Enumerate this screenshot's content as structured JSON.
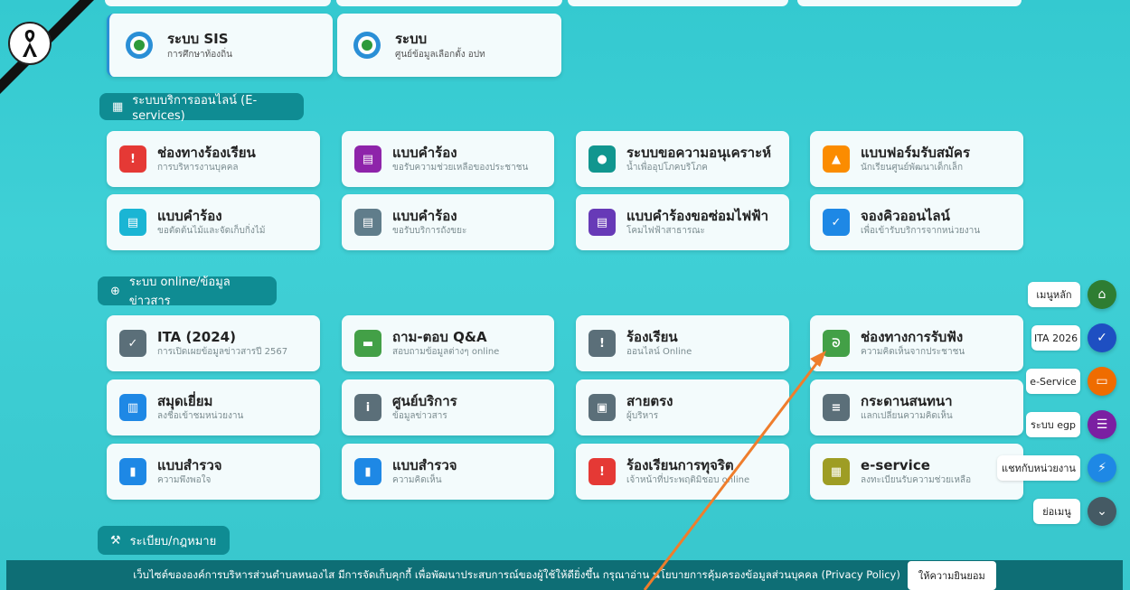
{
  "top_cards": [
    {
      "title": "ระบบ SIS",
      "subtitle": "การศึกษาท้องถิ่น"
    },
    {
      "title": "ระบบ",
      "subtitle": "ศูนย์ข้อมูลเลือกตั้ง อปท"
    }
  ],
  "sections": {
    "eservices": "ระบบบริการออนไลน์ (E-services)",
    "online": "ระบบ online/ข้อมูลข่าวสาร",
    "law": "ระเบียบ/กฎหมาย"
  },
  "eservice_cards": [
    {
      "title": "ช่องทางร้องเรียน",
      "subtitle": "การบริหารงานบุคคล",
      "color": "#e53935",
      "icon": "warning-icon"
    },
    {
      "title": "แบบคำร้อง",
      "subtitle": "ขอรับความช่วยเหลือของประชาชน",
      "color": "#8e24aa",
      "icon": "document-icon"
    },
    {
      "title": "ระบบขอความอนุเคราะห์",
      "subtitle": "น้ำเพื่ออุปโภคบริโภค",
      "color": "#11968f",
      "icon": "water-drop-icon"
    },
    {
      "title": "แบบฟอร์มรับสมัคร",
      "subtitle": "นักเรียนศูนย์พัฒนาเด็กเล็ก",
      "color": "#fb8c00",
      "icon": "graduation-cap-icon"
    },
    {
      "title": "แบบคำร้อง",
      "subtitle": "ขอตัดต้นไม้และจัดเก็บกิ่งไม้",
      "color": "#1ab5d4",
      "icon": "document-icon"
    },
    {
      "title": "แบบคำร้อง",
      "subtitle": "ขอรับบริการถังขยะ",
      "color": "#607d8b",
      "icon": "document-icon"
    },
    {
      "title": "แบบคำร้องขอซ่อมไฟฟ้า",
      "subtitle": "โคมไฟฟ้าสาธารณะ",
      "color": "#673ab7",
      "icon": "document-icon"
    },
    {
      "title": "จองคิวออนไลน์",
      "subtitle": "เพื่อเข้ารับบริการจากหน่วยงาน",
      "color": "#1e88e5",
      "icon": "calendar-check-icon"
    }
  ],
  "online_cards": [
    {
      "title": "ITA (2024)",
      "subtitle": "การเปิดเผยข้อมูลข่าวสารปี 2567",
      "color": "#5b6f79",
      "icon": "badge-check-icon"
    },
    {
      "title": "ถาม-ตอบ Q&A",
      "subtitle": "สอบถามข้อมูลต่างๆ online",
      "color": "#43a047",
      "icon": "chat-icon"
    },
    {
      "title": "ร้องเรียน",
      "subtitle": "ออนไลน์ Online",
      "color": "#5b6f79",
      "icon": "warning-icon"
    },
    {
      "title": "ช่องทางการรับฟัง",
      "subtitle": "ความคิดเห็นจากประชาชน",
      "color": "#43a047",
      "icon": "ear-icon"
    },
    {
      "title": "สมุดเยี่ยม",
      "subtitle": "ลงชื่อเข้าชมหน่วยงาน",
      "color": "#1e88e5",
      "icon": "book-icon"
    },
    {
      "title": "ศูนย์บริการ",
      "subtitle": "ข้อมูลข่าวสาร",
      "color": "#5b6f79",
      "icon": "info-icon"
    },
    {
      "title": "สายตรง",
      "subtitle": "ผู้บริหาร",
      "color": "#5b6f79",
      "icon": "contact-card-icon"
    },
    {
      "title": "กระดานสนทนา",
      "subtitle": "แลกเปลี่ยนความคิดเห็น",
      "color": "#5b6f79",
      "icon": "message-icon"
    },
    {
      "title": "แบบสำรวจ",
      "subtitle": "ความพึงพอใจ",
      "color": "#1e88e5",
      "icon": "poll-icon"
    },
    {
      "title": "แบบสำรวจ",
      "subtitle": "ความคิดเห็น",
      "color": "#1e88e5",
      "icon": "poll-icon"
    },
    {
      "title": "ร้องเรียนการทุจริต",
      "subtitle": "เจ้าหน้าที่ประพฤติมิชอบ online",
      "color": "#e53935",
      "icon": "warning-icon"
    },
    {
      "title": "e-service",
      "subtitle": "ลงทะเบียนรับความช่วยเหลือ",
      "color": "#9e9d24",
      "icon": "grid-icon"
    }
  ],
  "float_menu": [
    {
      "label": "เมนูหลัก",
      "color": "#2e7d32",
      "icon": "home-icon"
    },
    {
      "label": "ITA 2026",
      "color": "#1e4fc2",
      "icon": "badge-check-icon"
    },
    {
      "label": "e-Service",
      "color": "#ef6c00",
      "icon": "monitor-icon"
    },
    {
      "label": "ระบบ egp",
      "color": "#7b1fa2",
      "icon": "list-icon"
    },
    {
      "label": "แชทกับหน่วยงาน",
      "color": "#1e88e5",
      "icon": "messenger-icon"
    },
    {
      "label": "ย่อเมนู",
      "color": "#455a64",
      "icon": "chevron-down-icon"
    }
  ],
  "cookie": {
    "text": "เว็บไซต์ขององค์การบริหารส่วนตำบลหนองไส มีการจัดเก็บคุกกี้ เพื่อพัฒนาประสบการณ์ของผู้ใช้ให้ดียิ่งขึ้น กรุณาอ่าน นโยบายการคุ้มครองข้อมูลส่วนบุคคล (Privacy Policy)",
    "button": "ให้ความยินยอม"
  },
  "annotation_arrow_color": "#ef7d2c"
}
